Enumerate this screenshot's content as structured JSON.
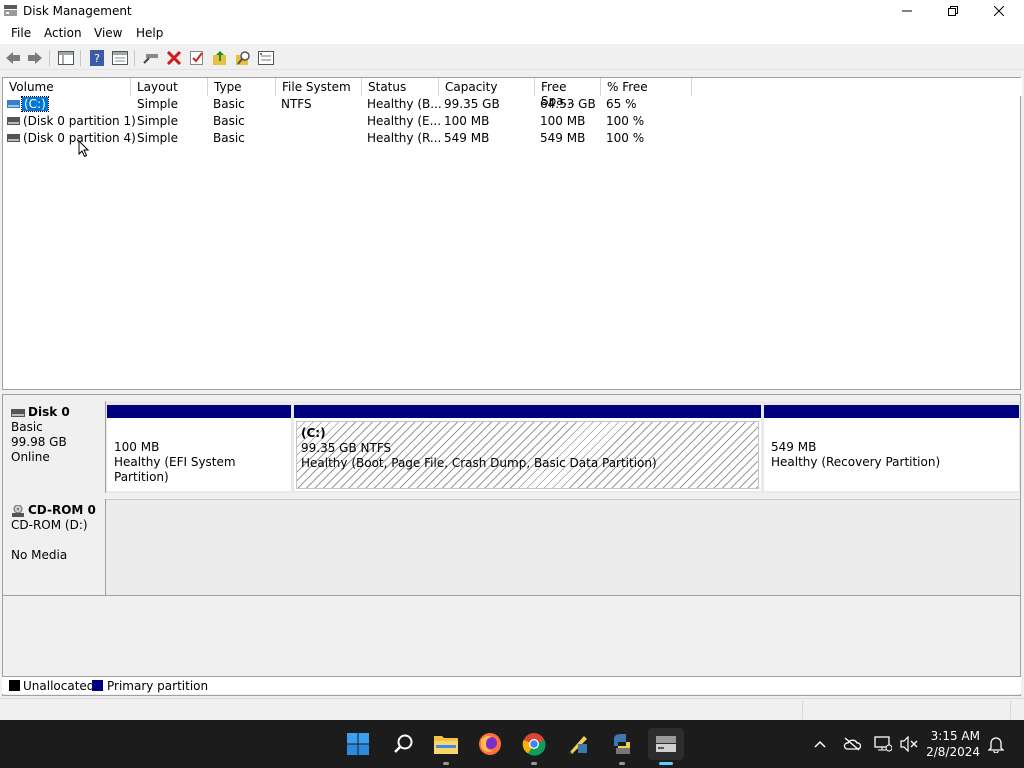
{
  "window": {
    "title": "Disk Management"
  },
  "menu": [
    "File",
    "Action",
    "View",
    "Help"
  ],
  "toolbar": {
    "icons": [
      "back-icon",
      "forward-icon",
      "console-tree-icon",
      "help-icon",
      "properties-icon",
      "connect-icon",
      "delete-icon",
      "check-icon",
      "up-folder-icon",
      "search-folder-icon",
      "list-icon"
    ]
  },
  "volume_list": {
    "columns": [
      "Volume",
      "Layout",
      "Type",
      "File System",
      "Status",
      "Capacity",
      "Free Spa...",
      "% Free"
    ],
    "rows": [
      {
        "volume": "(C:)",
        "layout": "Simple",
        "type": "Basic",
        "fs": "NTFS",
        "status": "Healthy (B...",
        "capacity": "99.35 GB",
        "free": "64.53 GB",
        "pct": "65 %"
      },
      {
        "volume": "(Disk 0 partition 1)",
        "layout": "Simple",
        "type": "Basic",
        "fs": "",
        "status": "Healthy (E...",
        "capacity": "100 MB",
        "free": "100 MB",
        "pct": "100 %"
      },
      {
        "volume": "(Disk 0 partition 4)",
        "layout": "Simple",
        "type": "Basic",
        "fs": "",
        "status": "Healthy (R...",
        "capacity": "549 MB",
        "free": "549 MB",
        "pct": "100 %"
      }
    ]
  },
  "disks": [
    {
      "name": "Disk 0",
      "type": "Basic",
      "size": "99.98 GB",
      "state": "Online",
      "partitions": [
        {
          "label": "",
          "size": "100 MB",
          "status": "Healthy (EFI System Partition)"
        },
        {
          "label": "(C:)",
          "size": "99.35 GB NTFS",
          "status": "Healthy (Boot, Page File, Crash Dump, Basic Data Partition)"
        },
        {
          "label": "",
          "size": "549 MB",
          "status": "Healthy (Recovery Partition)"
        }
      ]
    },
    {
      "name": "CD-ROM 0",
      "type": "CD-ROM (D:)",
      "size": "",
      "state": "No Media"
    }
  ],
  "legend": [
    {
      "label": "Unallocated",
      "color": "#000000"
    },
    {
      "label": "Primary partition",
      "color": "#00007f"
    }
  ],
  "taskbar": {
    "clock_time": "3:15 AM",
    "clock_date": "2/8/2024",
    "apps": [
      "start-icon",
      "search-icon",
      "file-explorer-icon",
      "firefox-icon",
      "chrome-icon",
      "python-idle-icon",
      "python-icon",
      "disk-management-icon"
    ]
  }
}
